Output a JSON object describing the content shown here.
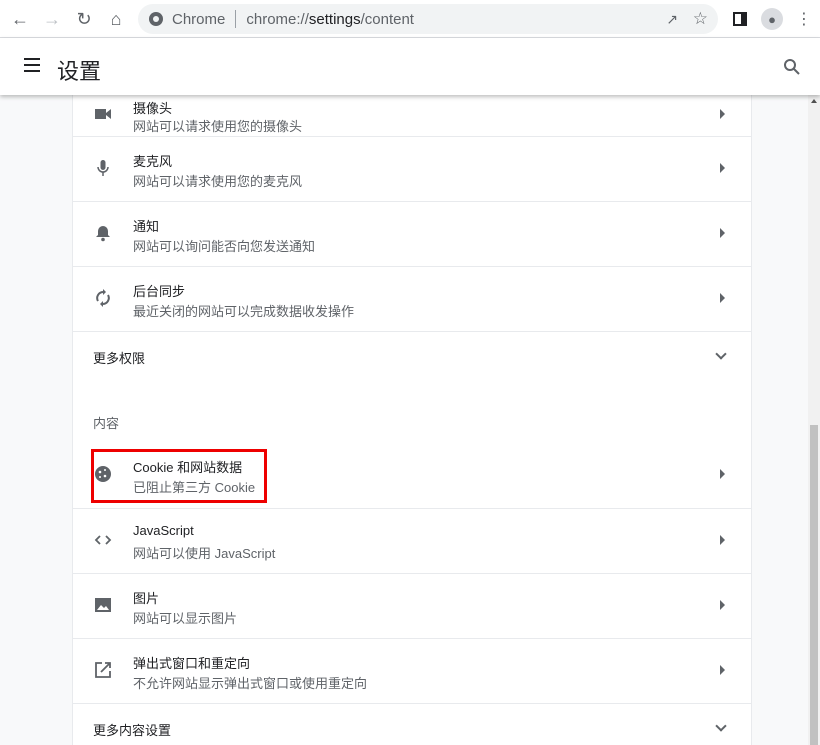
{
  "browser": {
    "chip": "Chrome",
    "url_scheme": "chrome://",
    "url_host": "settings",
    "url_path": "/content"
  },
  "header": {
    "title": "设置"
  },
  "permissions": [
    {
      "icon": "videocam-icon",
      "title": "摄像头",
      "subtitle": "网站可以请求使用您的摄像头"
    },
    {
      "icon": "mic-icon",
      "title": "麦克风",
      "subtitle": "网站可以请求使用您的麦克风"
    },
    {
      "icon": "bell-icon",
      "title": "通知",
      "subtitle": "网站可以询问能否向您发送通知"
    },
    {
      "icon": "sync-icon",
      "title": "后台同步",
      "subtitle": "最近关闭的网站可以完成数据收发操作"
    }
  ],
  "more_permissions": "更多权限",
  "content_section": "内容",
  "content": [
    {
      "icon": "cookie-icon",
      "title": "Cookie 和网站数据",
      "subtitle": "已阻止第三方 Cookie"
    },
    {
      "icon": "code-icon",
      "title": "JavaScript",
      "subtitle": "网站可以使用 JavaScript"
    },
    {
      "icon": "image-icon",
      "title": "图片",
      "subtitle": "网站可以显示图片"
    },
    {
      "icon": "open-in-new-icon",
      "title": "弹出式窗口和重定向",
      "subtitle": "不允许网站显示弹出式窗口或使用重定向"
    }
  ],
  "more_content": "更多内容设置",
  "highlight_color": "#ee0000"
}
